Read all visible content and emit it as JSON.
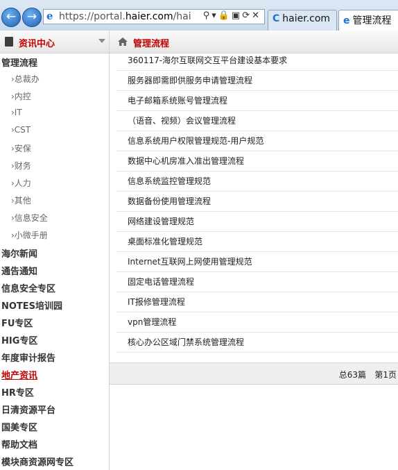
{
  "browser": {
    "url_prefix": "https://portal.",
    "url_domain": "haier.com",
    "url_rest": "/haierCms",
    "tabs": [
      {
        "label": "haier.com"
      },
      {
        "label": "管理流程"
      }
    ]
  },
  "sidebar": {
    "title": "资讯中心",
    "items": [
      {
        "label": "管理流程",
        "level": 0
      },
      {
        "label": "›总裁办",
        "level": 1
      },
      {
        "label": "›内控",
        "level": 1
      },
      {
        "label": "›IT",
        "level": 1
      },
      {
        "label": "›CST",
        "level": 1
      },
      {
        "label": "›安保",
        "level": 1
      },
      {
        "label": "›财务",
        "level": 1
      },
      {
        "label": "›人力",
        "level": 1
      },
      {
        "label": "›其他",
        "level": 1
      },
      {
        "label": "›信息安全",
        "level": 1
      },
      {
        "label": "›小微手册",
        "level": 1
      },
      {
        "label": "海尔新闻",
        "level": 0
      },
      {
        "label": "通告通知",
        "level": 0
      },
      {
        "label": "信息安全专区",
        "level": 0
      },
      {
        "label": "NOTES培训园",
        "level": 0
      },
      {
        "label": "FU专区",
        "level": 0
      },
      {
        "label": "HIG专区",
        "level": 0
      },
      {
        "label": "年度审计报告",
        "level": 0
      },
      {
        "label": "地产资讯",
        "level": 0,
        "active": true
      },
      {
        "label": "HR专区",
        "level": 0
      },
      {
        "label": "日清资源平台",
        "level": 0
      },
      {
        "label": "国美专区",
        "level": 0
      },
      {
        "label": "帮助文档",
        "level": 0
      },
      {
        "label": "模块商资源网专区",
        "level": 0
      }
    ]
  },
  "main": {
    "title": "管理流程",
    "rows": [
      "360117-海尔互联网交互平台建设基本要求",
      "服务器即需即供服务申请管理流程",
      "电子邮箱系统账号管理流程",
      "（语音、视频）会议管理流程",
      "信息系统用户权限管理规范-用户规范",
      "数据中心机房准入准出管理流程",
      "信息系统监控管理规范",
      "数据备份使用管理流程",
      "网络建设管理规范",
      "桌面标准化管理规范",
      "Internet互联网上网使用管理规范",
      "固定电话管理流程",
      "IT报修管理流程",
      "vpn管理流程",
      "核心办公区域门禁系统管理流程"
    ],
    "footer": {
      "total": "总63篇",
      "page": "第1页"
    }
  }
}
